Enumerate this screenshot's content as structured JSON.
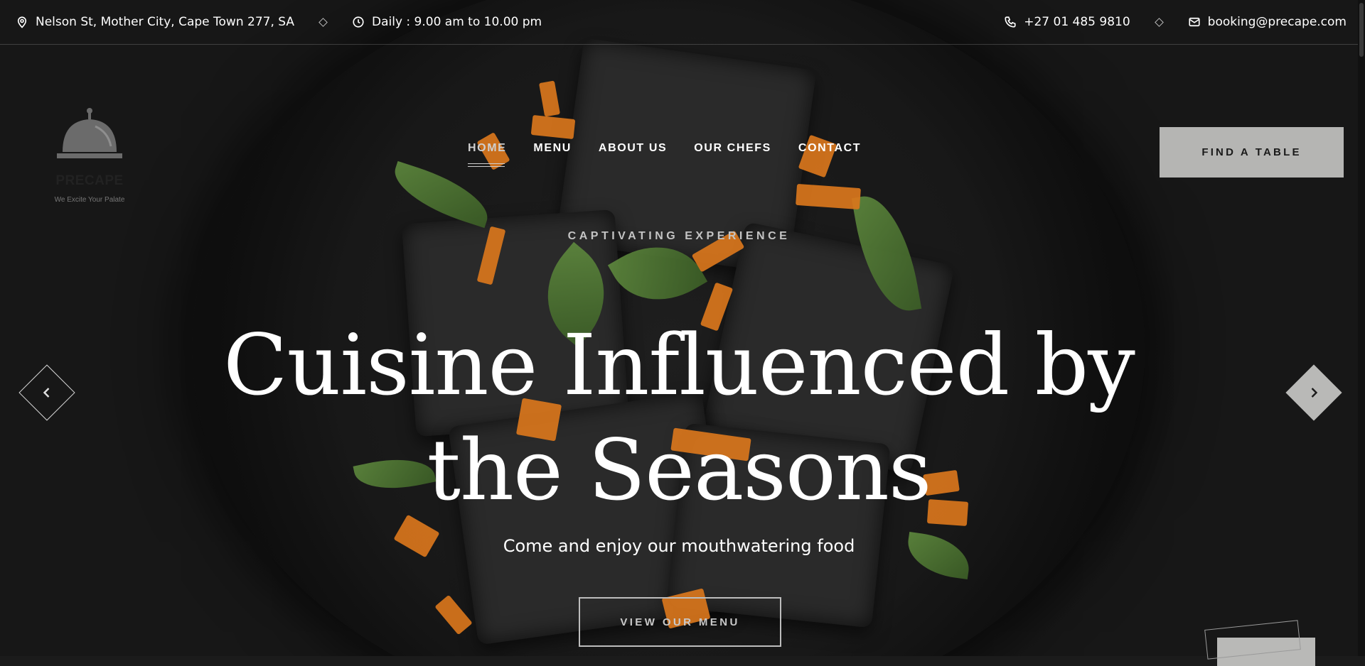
{
  "topbar": {
    "address": "Nelson St, Mother City, Cape Town 277, SA",
    "hours": "Daily : 9.00 am to 10.00 pm",
    "phone": "+27 01 485 9810",
    "email": "booking@precape.com"
  },
  "logo": {
    "name": "PRECAPE",
    "tagline": "We Excite Your Palate"
  },
  "nav": {
    "items": [
      {
        "label": "HOME",
        "active": true
      },
      {
        "label": "MENU",
        "active": false
      },
      {
        "label": "ABOUT US",
        "active": false
      },
      {
        "label": "OUR CHEFS",
        "active": false
      },
      {
        "label": "CONTACT",
        "active": false
      }
    ],
    "cta": "FIND A TABLE"
  },
  "hero": {
    "eyebrow": "CAPTIVATING EXPERIENCE",
    "headline_line1": "Cuisine Influenced by",
    "headline_line2": "the Seasons",
    "subline": "Come and enjoy our mouthwatering food",
    "button": "VIEW OUR MENU"
  },
  "icons": {
    "address": "map-pin-icon",
    "hours": "clock-icon",
    "phone": "phone-icon",
    "email": "mail-icon",
    "prev": "chevron-left-icon",
    "next": "chevron-right-icon"
  },
  "colors": {
    "accent": "#b5b5b3",
    "text": "#ffffff",
    "logo_gray": "#6b6b6b"
  }
}
